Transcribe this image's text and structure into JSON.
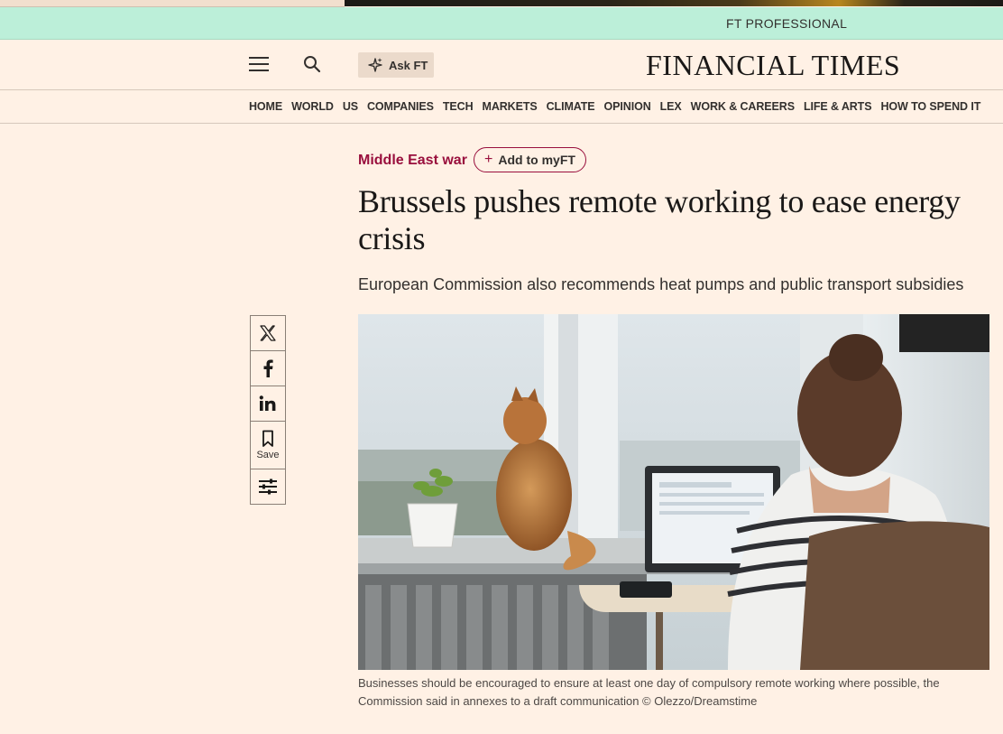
{
  "banner": {
    "label": "FT PROFESSIONAL"
  },
  "header": {
    "ask_label": "Ask FT",
    "logo": "FINANCIAL TIMES"
  },
  "nav": {
    "items": [
      "HOME",
      "WORLD",
      "US",
      "COMPANIES",
      "TECH",
      "MARKETS",
      "CLIMATE",
      "OPINION",
      "LEX",
      "WORK & CAREERS",
      "LIFE & ARTS",
      "HOW TO SPEND IT"
    ]
  },
  "article": {
    "topic": "Middle East war",
    "add_label": "Add to myFT",
    "headline": "Brussels pushes remote working to ease energy crisis",
    "standfirst": "European Commission also recommends heat pumps and public transport subsidies",
    "caption": "Businesses should be encouraged to ensure at least one day of compulsory remote working where possible, the Commission said in annexes to a draft communication © Olezzo/Dreamstime"
  },
  "share": {
    "save_label": "Save"
  },
  "icons": [
    "menu-icon",
    "search-icon",
    "sparkle-icon",
    "x-icon",
    "facebook-icon",
    "linkedin-icon",
    "bookmark-icon",
    "sliders-icon"
  ],
  "colors": {
    "background": "#fff1e5",
    "topic": "#990f3d",
    "pro_bar": "#bcefd9"
  }
}
